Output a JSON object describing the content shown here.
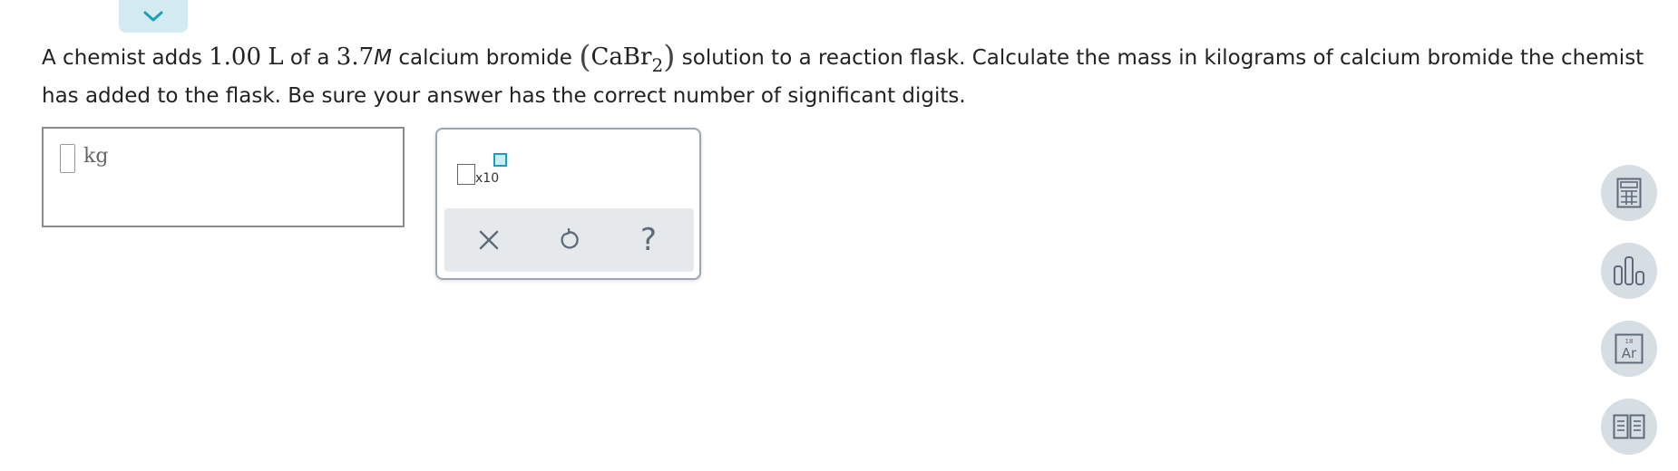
{
  "question": {
    "t1": "A chemist adds ",
    "volume_value": "1.00",
    "volume_unit": "L",
    "t2": " of a ",
    "molarity_value": "3.7",
    "molarity_unit": "M",
    "t3": " calcium bromide ",
    "open_paren": "(",
    "formula_main": "CaBr",
    "formula_sub": "2",
    "close_paren": ")",
    "t4": " solution to a reaction flask. Calculate the mass in kilograms of calcium bromide the chemist has added to the flask. Be sure your answer has the correct number of significant digits."
  },
  "answer": {
    "unit": "kg"
  },
  "tools": {
    "x10_label": "x10",
    "help_label": "?"
  },
  "side_toolbar": {
    "periodic_number": "18",
    "periodic_symbol": "Ar"
  },
  "colors": {
    "accent": "#1aa1b6",
    "tab_bg": "#d3ebf0",
    "icon_gray": "#5f6a7a",
    "side_btn_bg": "#d6dde3"
  }
}
